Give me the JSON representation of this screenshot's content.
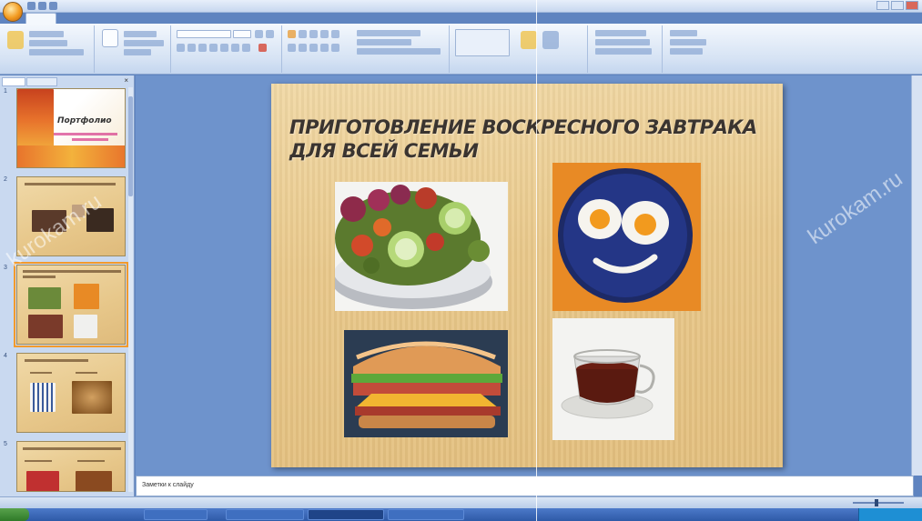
{
  "notes": {
    "placeholder": "Заметки к слайду"
  },
  "slide": {
    "title_line1": "ПРИГОТОВЛЕНИЕ ВОСКРЕСНОГО ЗАВТРАКА",
    "title_line2": "ДЛЯ ВСЕЙ СЕМЬИ"
  },
  "thumbnails": [
    {
      "num": "1",
      "title": "Портфолио"
    },
    {
      "num": "2"
    },
    {
      "num": "3"
    },
    {
      "num": "4"
    },
    {
      "num": "5"
    }
  ],
  "watermark": {
    "text": "kurokam.ru"
  },
  "icons": [
    "office-button-icon",
    "save-icon",
    "undo-icon",
    "close-icon",
    "start-icon"
  ],
  "colors": {
    "accent": "#f39a2b",
    "workspace": "#6e93cc",
    "slide_bg": "#e9c88a"
  }
}
